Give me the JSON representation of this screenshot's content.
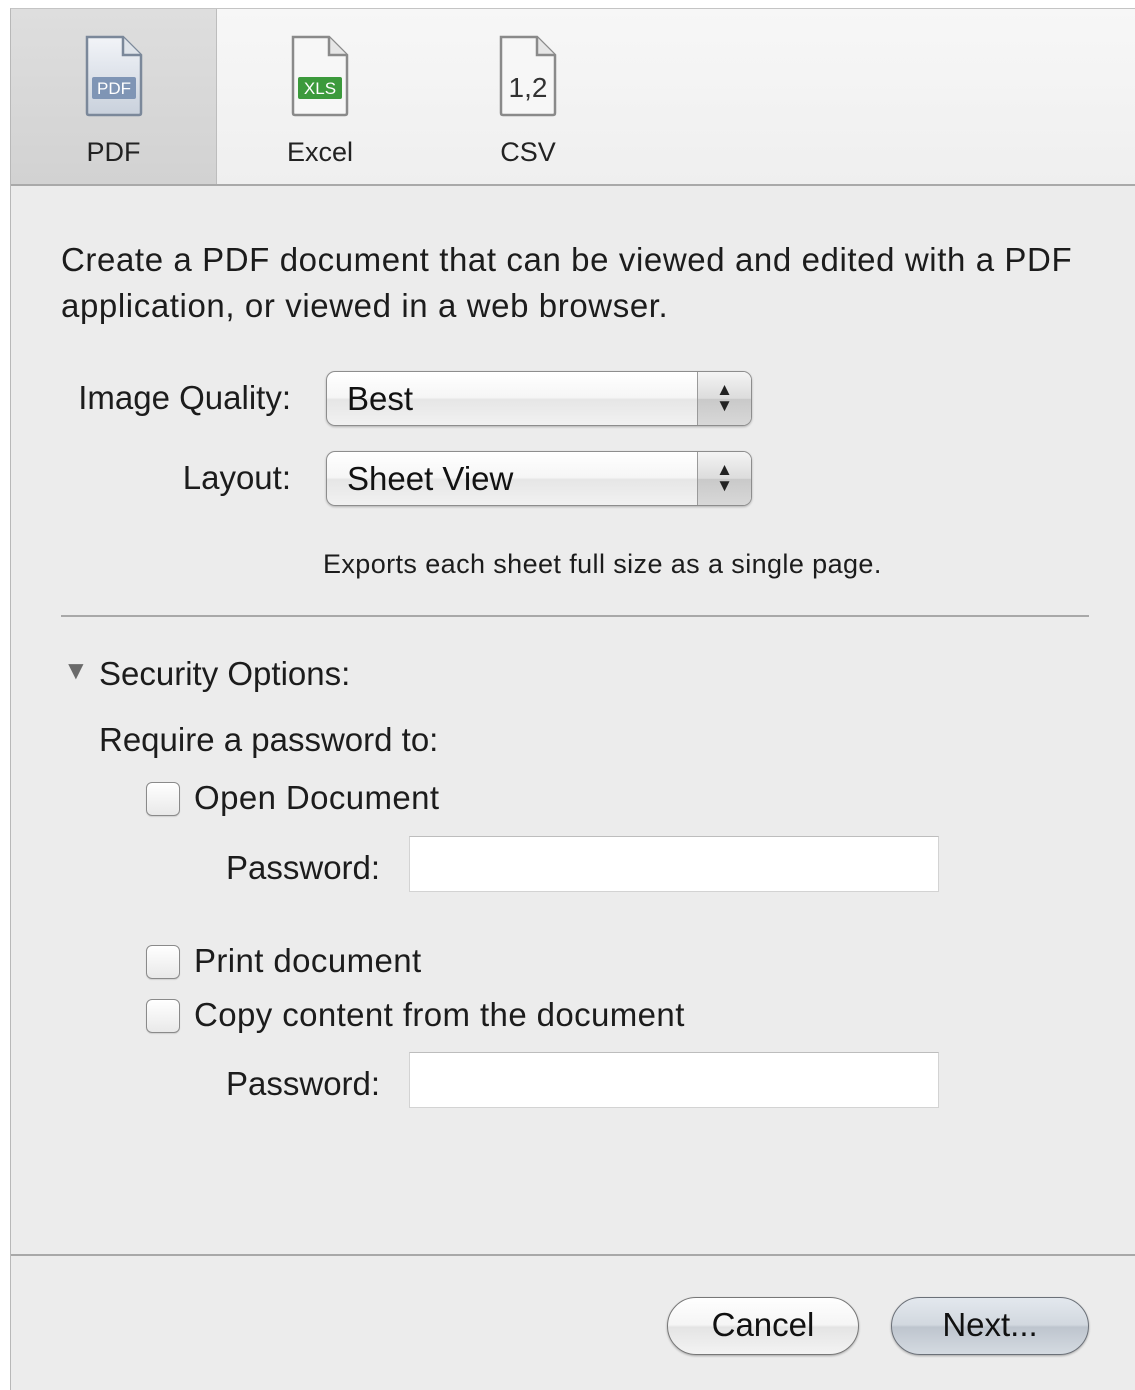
{
  "toolbar": {
    "items": [
      {
        "label": "PDF",
        "icon": "pdf-document-icon",
        "badge": "PDF",
        "selected": true
      },
      {
        "label": "Excel",
        "icon": "xls-document-icon",
        "badge": "XLS",
        "selected": false
      },
      {
        "label": "CSV",
        "icon": "csv-document-icon",
        "badge": "1,2",
        "selected": false
      }
    ]
  },
  "description": "Create a PDF document that can be viewed and edited with a PDF application, or viewed in a web browser.",
  "image_quality": {
    "label": "Image Quality:",
    "value": "Best"
  },
  "layout": {
    "label": "Layout:",
    "value": "Sheet View",
    "hint": "Exports each sheet full size as a single page."
  },
  "security": {
    "title": "Security Options:",
    "expanded": true,
    "require_title": "Require a password to:",
    "open_document": {
      "label": "Open Document",
      "checked": false,
      "password_label": "Password:",
      "password_value": ""
    },
    "print_document": {
      "label": "Print document",
      "checked": false
    },
    "copy_content": {
      "label": "Copy content from the document",
      "checked": false,
      "password_label": "Password:",
      "password_value": ""
    }
  },
  "buttons": {
    "cancel": "Cancel",
    "next": "Next..."
  },
  "colors": {
    "dialog_bg": "#ececec",
    "pdf_badge": "#7f95b5",
    "xls_badge": "#3c9a3c"
  }
}
